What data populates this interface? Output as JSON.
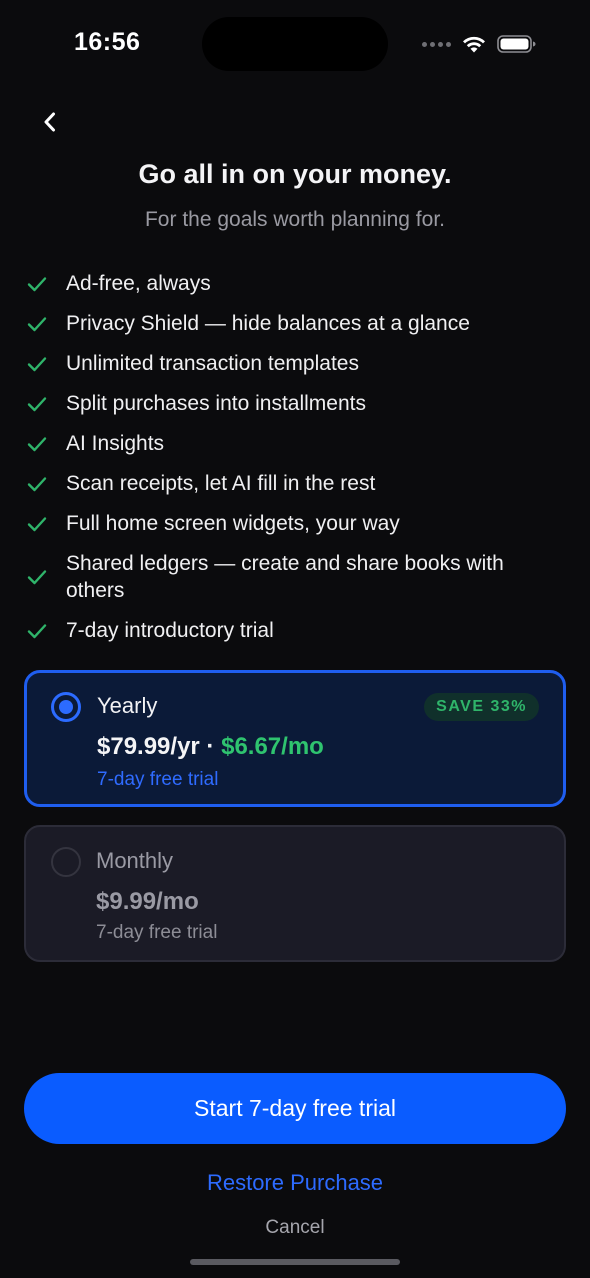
{
  "status_bar": {
    "time": "16:56",
    "icons": [
      "signal-dots-icon",
      "wifi-icon",
      "battery-icon"
    ]
  },
  "nav": {
    "back_icon": "chevron-left-icon"
  },
  "header": {
    "title": "Go all in on your money.",
    "subtitle": "For the goals worth planning for."
  },
  "features": [
    "Ad-free, always",
    "Privacy Shield — hide balances at a glance",
    "Unlimited transaction templates",
    "Split purchases into installments",
    "AI Insights",
    "Scan receipts, let AI fill in the rest",
    "Full home screen widgets, your way",
    "Shared ledgers — create and share books with others",
    "7-day introductory trial"
  ],
  "plans": {
    "yearly": {
      "name": "Yearly",
      "price": "$79.99/yr",
      "separator": " · ",
      "per_month": "$6.67/mo",
      "trial": "7-day free trial",
      "badge": "SAVE 33%",
      "selected": true
    },
    "monthly": {
      "name": "Monthly",
      "price": "$9.99/mo",
      "trial": "7-day free trial",
      "selected": false
    }
  },
  "actions": {
    "cta_label": "Start 7-day free trial",
    "restore_label": "Restore Purchase",
    "cancel_label": "Cancel"
  },
  "colors": {
    "background": "#0b0b0d",
    "accent_blue": "#0a5cff",
    "accent_green": "#2fc36f",
    "check_green": "#2fb46a"
  }
}
